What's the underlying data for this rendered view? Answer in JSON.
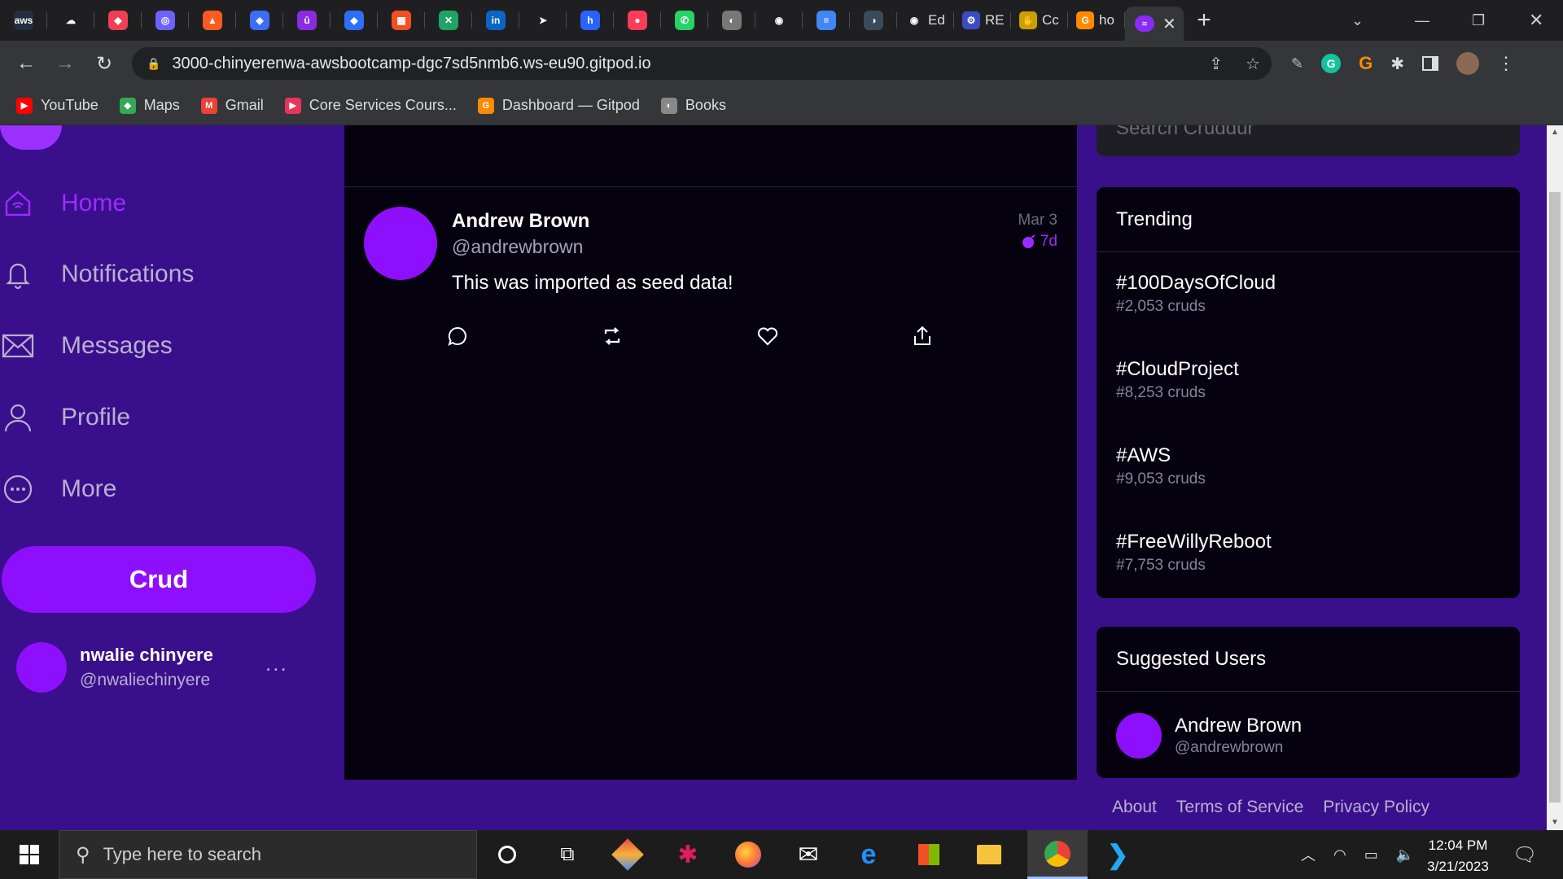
{
  "browser": {
    "tabs": [
      {
        "icon": "aws-icon",
        "glyph": "aws",
        "color": "#232f3e"
      },
      {
        "icon": "cloud-icon",
        "glyph": "☁",
        "color": "#1f1f22"
      },
      {
        "icon": "pocket-icon",
        "glyph": "◆",
        "color": "#ef3f56"
      },
      {
        "icon": "hashnode-icon",
        "glyph": "◎",
        "color": "#6c63ff"
      },
      {
        "icon": "fire-icon",
        "glyph": "▲",
        "color": "#ff5a1f"
      },
      {
        "icon": "shield-icon",
        "glyph": "◈",
        "color": "#3b6df6"
      },
      {
        "icon": "u-icon",
        "glyph": "ū",
        "color": "#8a2be2"
      },
      {
        "icon": "diamond-icon",
        "glyph": "◆",
        "color": "#2d6ff6"
      },
      {
        "icon": "microsoft-icon",
        "glyph": "▦",
        "color": "#f25022"
      },
      {
        "icon": "app-icon",
        "glyph": "✕",
        "color": "#21a366"
      },
      {
        "icon": "linkedin-icon",
        "glyph": "in",
        "color": "#0a66c2"
      },
      {
        "icon": "send-icon",
        "glyph": "➤",
        "color": "#1f1f22"
      },
      {
        "icon": "hashnode-h-icon",
        "glyph": "h",
        "color": "#2962ff"
      },
      {
        "icon": "record-icon",
        "glyph": "●",
        "color": "#ff3b5c"
      },
      {
        "icon": "whatsapp-icon",
        "glyph": "✆",
        "color": "#25d366"
      },
      {
        "icon": "globe-icon",
        "glyph": "◐",
        "color": "#777777"
      },
      {
        "icon": "github-icon",
        "glyph": "◉",
        "color": "#1f1f22"
      },
      {
        "icon": "docs-icon",
        "glyph": "≡",
        "color": "#4285f4"
      },
      {
        "icon": "moon-icon",
        "glyph": "◑",
        "color": "#3a4a5a"
      }
    ],
    "named_tabs": [
      {
        "icon": "github-icon",
        "glyph": "◉",
        "color": "#1f1f22",
        "label": "Ed"
      },
      {
        "icon": "settings-icon",
        "glyph": "⚙",
        "color": "#3b4cc0",
        "label": "RE"
      },
      {
        "icon": "hands-icon",
        "glyph": "✋",
        "color": "#c8a000",
        "label": "Cc"
      },
      {
        "icon": "gitpod-icon",
        "glyph": "G",
        "color": "#ff8a00",
        "label": "ho"
      }
    ],
    "active_tab": {
      "icon": "cruddur-icon",
      "glyph": "≋"
    },
    "url": "3000-chinyerenwa-awsbootcamp-dgc7sd5nmb6.ws-eu90.gitpod.io",
    "bookmarks": [
      {
        "label": "YouTube",
        "icon": "youtube-icon",
        "glyph": "▶",
        "color": "#ff0000"
      },
      {
        "label": "Maps",
        "icon": "maps-icon",
        "glyph": "◆",
        "color": "#34a853"
      },
      {
        "label": "Gmail",
        "icon": "gmail-icon",
        "glyph": "M",
        "color": "#ea4335"
      },
      {
        "label": "Core Services Cours...",
        "icon": "course-icon",
        "glyph": "▶",
        "color": "#e8345a"
      },
      {
        "label": "Dashboard — Gitpod",
        "icon": "gitpod-icon",
        "glyph": "G",
        "color": "#ff8a00"
      },
      {
        "label": "Books",
        "icon": "books-icon",
        "glyph": "◐",
        "color": "#888888"
      }
    ]
  },
  "app": {
    "nav": [
      {
        "label": "Home",
        "icon": "home-icon",
        "active": true
      },
      {
        "label": "Notifications",
        "icon": "bell-icon",
        "active": false
      },
      {
        "label": "Messages",
        "icon": "mail-icon",
        "active": false
      },
      {
        "label": "Profile",
        "icon": "user-icon",
        "active": false
      },
      {
        "label": "More",
        "icon": "more-circle-icon",
        "active": false
      }
    ],
    "crud_button": "Crud",
    "current_user": {
      "name": "nwalie chinyere",
      "handle": "@nwaliechinyere",
      "more": "..."
    },
    "search_placeholder": "Search Cruddur",
    "post": {
      "name": "Andrew Brown",
      "handle": "@andrewbrown",
      "date": "Mar 3",
      "ago": "7d",
      "message": "This was imported as seed data!"
    },
    "trending": {
      "title": "Trending",
      "items": [
        {
          "tag": "#100DaysOfCloud",
          "count": "#2,053 cruds"
        },
        {
          "tag": "#CloudProject",
          "count": "#8,253 cruds"
        },
        {
          "tag": "#AWS",
          "count": "#9,053 cruds"
        },
        {
          "tag": "#FreeWillyReboot",
          "count": "#7,753 cruds"
        }
      ]
    },
    "suggested": {
      "title": "Suggested Users",
      "users": [
        {
          "name": "Andrew Brown",
          "handle": "@andrewbrown"
        }
      ]
    },
    "footer": [
      "About",
      "Terms of Service",
      "Privacy Policy"
    ]
  },
  "taskbar": {
    "search_placeholder": "Type here to search",
    "time": "12:04 PM",
    "date": "3/21/2023"
  },
  "colors": {
    "accent": "#8e0ffc",
    "background": "#3a0f8c",
    "panel": "#05010f"
  }
}
